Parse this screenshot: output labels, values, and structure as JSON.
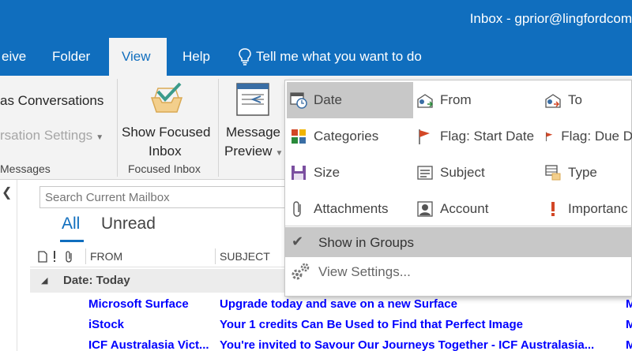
{
  "window": {
    "title": "Inbox - gprior@lingfordcom"
  },
  "tabs": [
    {
      "label": "eive"
    },
    {
      "label": "Folder"
    },
    {
      "label": "View"
    },
    {
      "label": "Help"
    }
  ],
  "tellme": {
    "label": "Tell me what you want to do"
  },
  "ribbon": {
    "conversations_label": "as Conversations",
    "conversation_settings_label": "rsation Settings",
    "messages_group_label": "Messages",
    "focused_line1": "Show Focused",
    "focused_line2": "Inbox",
    "focused_group_label": "Focused Inbox",
    "preview_line1": "Message",
    "preview_line2": "Preview"
  },
  "arrange_menu": {
    "items": [
      {
        "label": "Date",
        "icon": "calendar-clock-icon"
      },
      {
        "label": "From",
        "icon": "envelope-person-icon"
      },
      {
        "label": "To",
        "icon": "envelope-person-to-icon"
      },
      {
        "label": "Categories",
        "icon": "categories-icon"
      },
      {
        "label": "Flag: Start Date",
        "icon": "flag-icon"
      },
      {
        "label": "Flag: Due D",
        "icon": "flag-icon"
      },
      {
        "label": "Size",
        "icon": "size-icon"
      },
      {
        "label": "Subject",
        "icon": "subject-icon"
      },
      {
        "label": "Type",
        "icon": "type-icon"
      },
      {
        "label": "Attachments",
        "icon": "paperclip-icon"
      },
      {
        "label": "Account",
        "icon": "account-icon"
      },
      {
        "label": "Importanc",
        "icon": "importance-icon"
      }
    ],
    "show_in_groups": "Show in Groups",
    "view_settings": "View Settings..."
  },
  "mail": {
    "search_placeholder": "Search Current Mailbox",
    "filter_all": "All",
    "filter_unread": "Unread",
    "col_from": "FROM",
    "col_subject": "SUBJECT",
    "group_header": "Date: Today",
    "rows": [
      {
        "from": "Microsoft Surface",
        "subject": "Upgrade today and save on a new Surface",
        "extra": "M"
      },
      {
        "from": "iStock",
        "subject": "Your 1 credits Can Be Used to Find that Perfect Image",
        "extra": "M"
      },
      {
        "from": "ICF Australasia Vict...",
        "subject": "You're invited to Savour Our Journeys Together - ICF Australasia...",
        "extra": "M"
      }
    ]
  },
  "colors": {
    "brand": "#106ebe",
    "unread": "#0000ff",
    "accent_orange": "#d24726"
  }
}
